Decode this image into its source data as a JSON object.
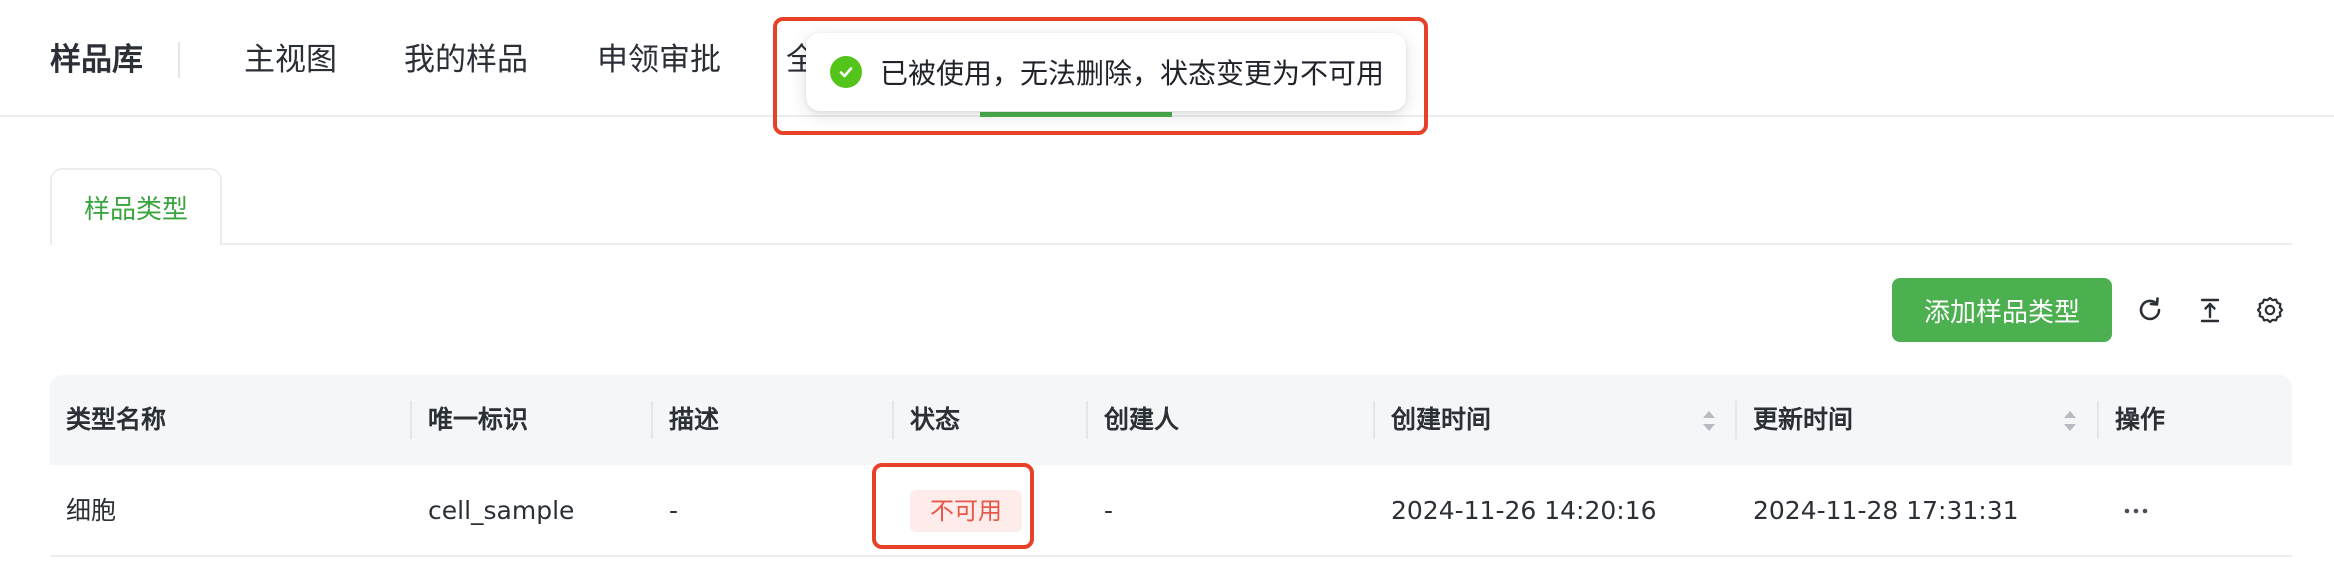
{
  "header": {
    "brand": "样品库",
    "nav": [
      {
        "label": "主视图"
      },
      {
        "label": "我的样品"
      },
      {
        "label": "申领审批"
      },
      {
        "label": "全"
      }
    ]
  },
  "toast": {
    "message": "已被使用，无法删除，状态变更为不可用",
    "type": "success",
    "icon": "check-circle-icon"
  },
  "tabs": [
    {
      "label": "样品类型",
      "active": true
    }
  ],
  "toolbar": {
    "add_label": "添加样品类型",
    "icons": [
      "refresh-icon",
      "upload-icon",
      "settings-icon"
    ]
  },
  "table": {
    "columns": [
      {
        "label": "类型名称"
      },
      {
        "label": "唯一标识"
      },
      {
        "label": "描述"
      },
      {
        "label": "状态"
      },
      {
        "label": "创建人"
      },
      {
        "label": "创建时间",
        "sortable": true
      },
      {
        "label": "更新时间",
        "sortable": true
      },
      {
        "label": "操作"
      }
    ],
    "rows": [
      {
        "name": "细胞",
        "identifier": "cell_sample",
        "description": "-",
        "status": "不可用",
        "creator": "-",
        "created_at": "2024-11-26 14:20:16",
        "updated_at": "2024-11-28 17:31:31",
        "actions": "···"
      }
    ]
  },
  "colors": {
    "accent": "#4caf50",
    "highlight_frame": "#e8412a",
    "status_unavailable_bg": "#fdecea",
    "status_unavailable_text": "#e5584a"
  }
}
